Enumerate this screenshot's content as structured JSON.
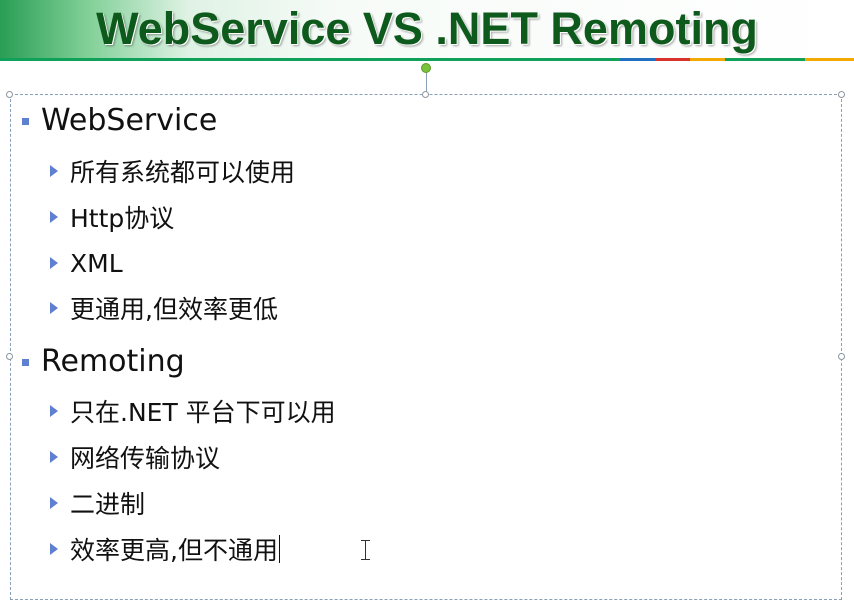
{
  "slide": {
    "title": "WebService VS .NET Remoting",
    "colors": {
      "title_text": "#0e5a1c",
      "title_band": "#2a9d54",
      "bullet": "#5f7fd1",
      "accent_segments": [
        "#0fa05a",
        "#1e6fc0",
        "#d6332a",
        "#f2a900",
        "#0fa05a",
        "#f2a900"
      ]
    },
    "bullets": [
      {
        "label": "WebService",
        "subitems": [
          "所有系统都可以使用",
          "Http协议",
          "XML",
          "更通用,但效率更低"
        ]
      },
      {
        "label": "Remoting",
        "subitems": [
          "只在.NET 平台下可以用",
          "网络传输协议",
          "二进制",
          "效率更高,但不通用"
        ]
      }
    ]
  },
  "icons": {
    "level1_bullet": "square-bullet-icon",
    "level2_bullet": "triangle-arrow-bullet-icon",
    "cursor": "ibeam-cursor-icon",
    "rotate": "rotate-handle-icon"
  }
}
